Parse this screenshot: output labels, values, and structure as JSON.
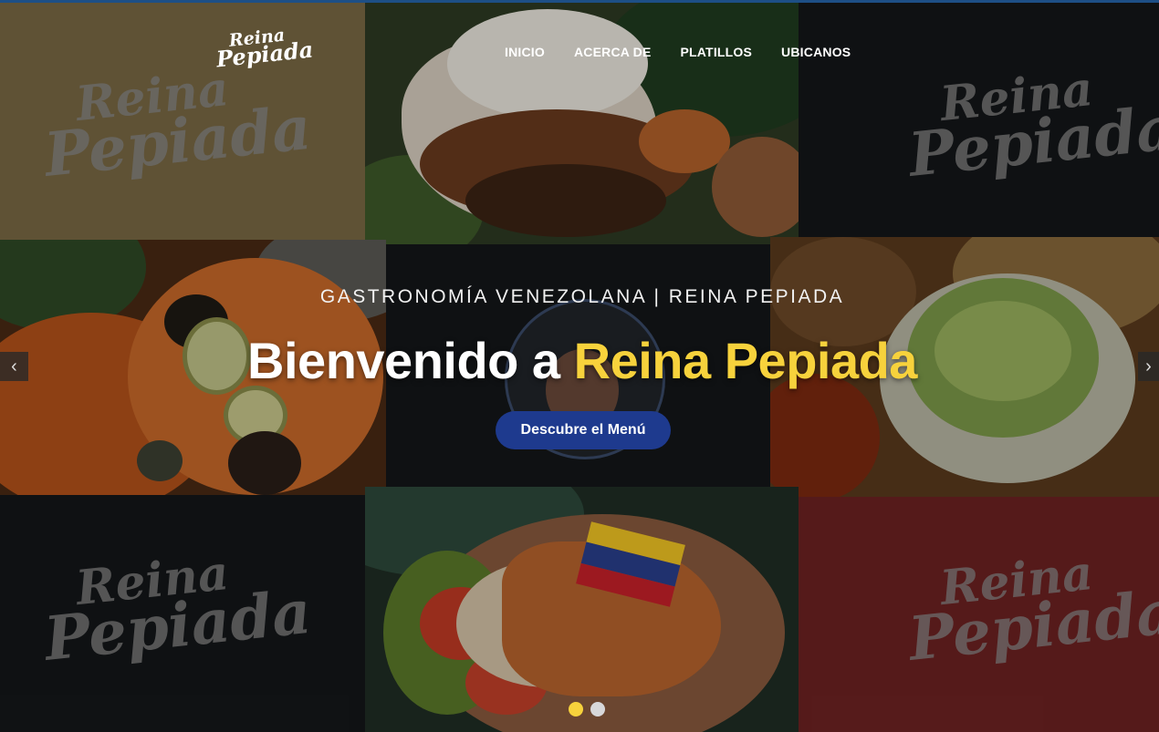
{
  "brand": {
    "line1": "Reina",
    "line2": "Pepiada"
  },
  "nav": {
    "items": [
      "INICIO",
      "ACERCA DE",
      "PLATILLOS",
      "UBICANOS"
    ]
  },
  "hero": {
    "subtitle": "GASTRONOMÍA VENEZOLANA | REINA PEPIADA",
    "title_prefix": "Bienvenido a ",
    "title_accent": "Reina Pepiada",
    "cta_label": "Descubre el Menú"
  },
  "watermark": {
    "line1": "Reina",
    "line2": "Pepiada"
  },
  "carousel": {
    "prev_icon": "chevron-left-icon",
    "next_icon": "chevron-right-icon",
    "prev_glyph": "‹",
    "next_glyph": "›",
    "slides": 2,
    "active": 1
  },
  "colors": {
    "gold_tile": "#7a6a45",
    "dark_tile": "#141719",
    "red_tile": "#6e2222",
    "accent": "#f7d23c",
    "cta": "#1e3a8e"
  }
}
